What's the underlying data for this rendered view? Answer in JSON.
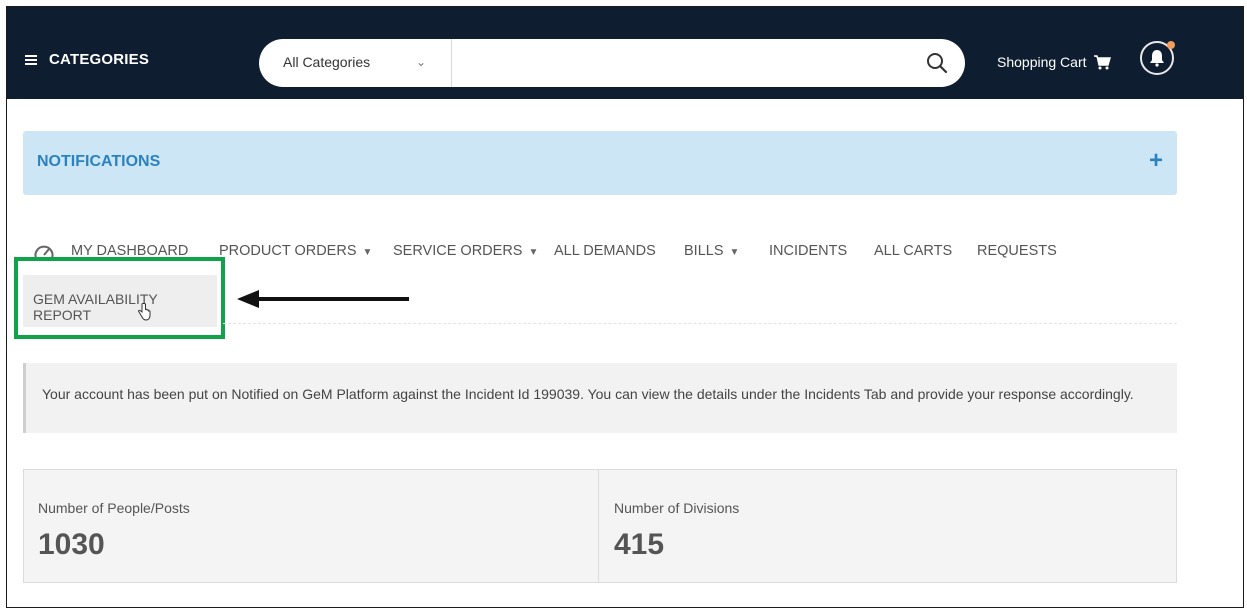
{
  "header": {
    "categories_label": "CATEGORIES",
    "search": {
      "category_selected": "All Categories",
      "placeholder": ""
    },
    "cart_label": "Shopping Cart"
  },
  "notifications": {
    "title": "NOTIFICATIONS",
    "expand_symbol": "+"
  },
  "nav": {
    "tabs": [
      {
        "label": "MY DASHBOARD",
        "has_caret": false
      },
      {
        "label": "PRODUCT ORDERS",
        "has_caret": true
      },
      {
        "label": "SERVICE ORDERS",
        "has_caret": true
      },
      {
        "label": "ALL DEMANDS",
        "has_caret": false
      },
      {
        "label": "BILLS",
        "has_caret": true
      },
      {
        "label": "INCIDENTS",
        "has_caret": false
      },
      {
        "label": "ALL CARTS",
        "has_caret": false
      },
      {
        "label": "REQUESTS",
        "has_caret": false
      }
    ],
    "second_row": {
      "label": "GEM AVAILABILITY REPORT"
    }
  },
  "alert": {
    "message": "Your account has been put on Notified on GeM Platform against the Incident Id 199039. You can view the details under the Incidents Tab and provide your response accordingly."
  },
  "stats": [
    {
      "label": "Number of People/Posts",
      "value": "1030"
    },
    {
      "label": "Number of Divisions",
      "value": "415"
    }
  ],
  "colors": {
    "topbar": "#0e1e30",
    "notification_bg": "#cde6f6",
    "notification_text": "#2b82bf",
    "highlight_outline": "#10a34a"
  },
  "icons": [
    "hamburger-icon",
    "chevron-down-icon",
    "search-icon",
    "cart-icon",
    "bell-icon",
    "dashboard-gauge-icon",
    "caret-down-icon",
    "hand-cursor-icon",
    "arrow-left-icon"
  ]
}
